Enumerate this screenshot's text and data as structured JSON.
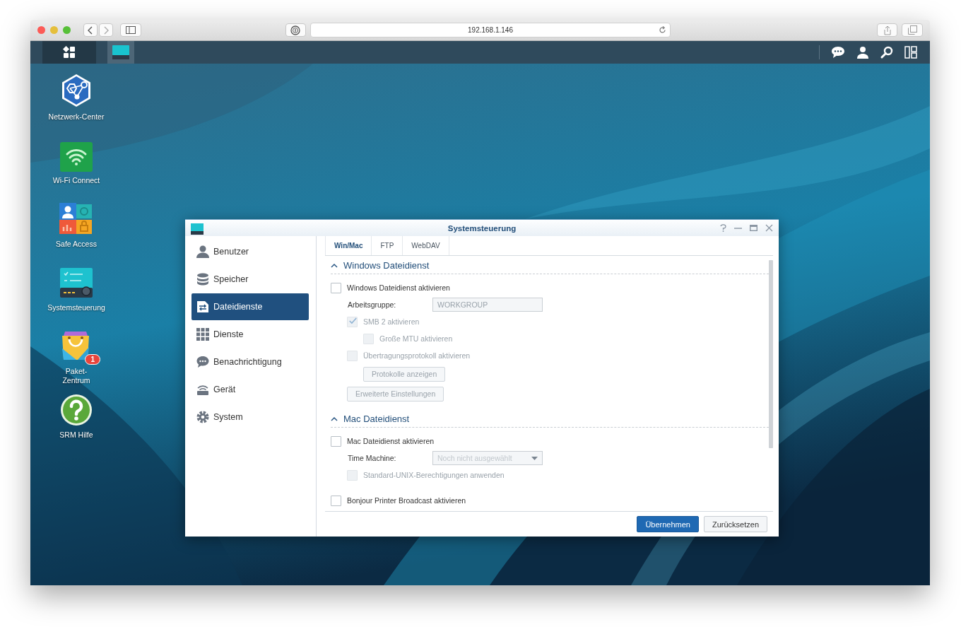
{
  "browser": {
    "url": "192.168.1.146"
  },
  "taskbar": {
    "apps": [
      {
        "selected": false
      },
      {
        "selected": true
      }
    ]
  },
  "desktop_icons": [
    {
      "label": "Netzwerk-Center"
    },
    {
      "label": "Wi-Fi Connect"
    },
    {
      "label": "Safe Access"
    },
    {
      "label": "Systemsteuerung"
    },
    {
      "label": "Paket-\nZentrum",
      "badge": "1"
    },
    {
      "label": "SRM Hilfe"
    }
  ],
  "dialog": {
    "title": "Systemsteuerung",
    "sidebar": [
      {
        "label": "Benutzer",
        "selected": false
      },
      {
        "label": "Speicher",
        "selected": false
      },
      {
        "label": "Dateidienste",
        "selected": true
      },
      {
        "label": "Dienste",
        "selected": false
      },
      {
        "label": "Benachrichtigung",
        "selected": false
      },
      {
        "label": "Gerät",
        "selected": false
      },
      {
        "label": "System",
        "selected": false
      }
    ],
    "tabs": [
      {
        "label": "Win/Mac",
        "selected": true
      },
      {
        "label": "FTP",
        "selected": false
      },
      {
        "label": "WebDAV",
        "selected": false
      }
    ],
    "sections": [
      {
        "title": "Windows Dateidienst",
        "expanded": true,
        "items": [
          {
            "kind": "checkbox",
            "label": "Windows Dateidienst aktivieren",
            "checked": false,
            "disabled": false,
            "children": [
              {
                "kind": "field",
                "label": "Arbeitsgruppe:",
                "value": "WORKGROUP",
                "disabled": true
              },
              {
                "kind": "checkbox",
                "label": "SMB 2 aktivieren",
                "checked": true,
                "disabled": true,
                "children": [
                  {
                    "kind": "checkbox",
                    "label": "Große MTU aktivieren",
                    "checked": false,
                    "disabled": true
                  }
                ]
              },
              {
                "kind": "checkbox",
                "label": "Übertragungsprotokoll aktivieren",
                "checked": false,
                "disabled": true,
                "children": [
                  {
                    "kind": "button",
                    "label": "Protokolle anzeigen",
                    "disabled": true
                  }
                ]
              },
              {
                "kind": "button",
                "label": "Erweiterte Einstellungen",
                "disabled": true
              }
            ]
          }
        ]
      },
      {
        "title": "Mac Dateidienst",
        "expanded": true,
        "items": [
          {
            "kind": "checkbox",
            "label": "Mac Dateidienst aktivieren",
            "checked": false,
            "disabled": false,
            "children": [
              {
                "kind": "select",
                "label": "Time Machine:",
                "value": "Noch nicht ausgewählt",
                "disabled": true
              },
              {
                "kind": "checkbox",
                "label": "Standard-UNIX-Berechtigungen anwenden",
                "checked": false,
                "disabled": true
              }
            ]
          },
          {
            "kind": "checkbox",
            "label": "Bonjour Printer Broadcast aktivieren",
            "checked": false,
            "disabled": false
          }
        ]
      }
    ],
    "buttons": [
      {
        "label": "Übernehmen",
        "kind": "primary"
      },
      {
        "label": "Zurücksetzen",
        "kind": "default"
      }
    ]
  }
}
